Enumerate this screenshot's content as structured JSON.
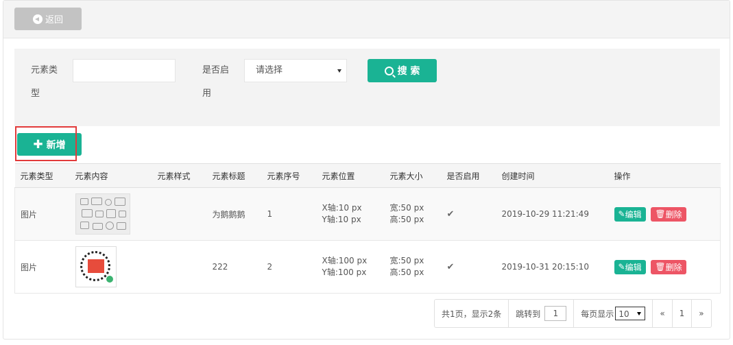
{
  "toolbar": {
    "back_label": "返回"
  },
  "search": {
    "type_label": "元素类型",
    "type_value": "",
    "enabled_label": "是否启用",
    "enabled_selected": "请选择",
    "search_label": "搜 索"
  },
  "actions": {
    "add_label": "新增"
  },
  "table": {
    "headers": [
      "元素类型",
      "元素内容",
      "元素样式",
      "元素标题",
      "元素序号",
      "元素位置",
      "元素大小",
      "是否启用",
      "创建时间",
      "操作"
    ],
    "rows": [
      {
        "type": "图片",
        "style": "",
        "title": "为鹅鹅鹅",
        "order": "1",
        "pos_x": "X轴:10 px",
        "pos_y": "Y轴:10 px",
        "size_w": "宽:50 px",
        "size_h": "高:50 px",
        "enabled_icon": "check-icon",
        "created": "2019-10-29 11:21:49"
      },
      {
        "type": "图片",
        "style": "",
        "title": "222",
        "order": "2",
        "pos_x": "X轴:100 px",
        "pos_y": "Y轴:100 px",
        "size_w": "宽:50 px",
        "size_h": "高:50 px",
        "enabled_icon": "check-icon",
        "created": "2019-10-31 20:15:10"
      }
    ],
    "edit_label": "编辑",
    "delete_label": "删除"
  },
  "pagination": {
    "summary": "共1页，显示2条",
    "jump_label": "跳转到",
    "jump_value": "1",
    "per_page_label": "每页显示",
    "per_page_value": "10",
    "prev": "«",
    "current": "1",
    "next": "»"
  },
  "colors": {
    "primary": "#1ab394",
    "danger": "#ed5565",
    "highlight": "#e23a3a"
  }
}
